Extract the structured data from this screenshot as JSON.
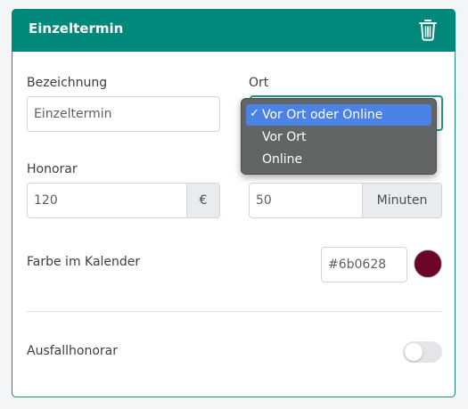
{
  "card": {
    "title": "Einzeltermin",
    "delete_icon": "trash-icon",
    "header_color": "#00897b"
  },
  "fields": {
    "bezeichnung": {
      "label": "Bezeichnung",
      "value": "Einzeltermin"
    },
    "ort": {
      "label": "Ort",
      "selected": "Vor Ort oder Online",
      "options": [
        "Vor Ort oder Online",
        "Vor Ort",
        "Online"
      ]
    },
    "honorar": {
      "label": "Honorar",
      "value": "120",
      "unit": "€"
    },
    "dauer": {
      "value": "50",
      "unit": "Minuten"
    },
    "farbe": {
      "label": "Farbe im Kalender",
      "value": "#6b0628",
      "swatch_color": "#6b0628"
    },
    "ausfallhonorar": {
      "label": "Ausfallhonorar",
      "enabled": false
    }
  },
  "dropdown": {
    "check_mark": "✓"
  }
}
